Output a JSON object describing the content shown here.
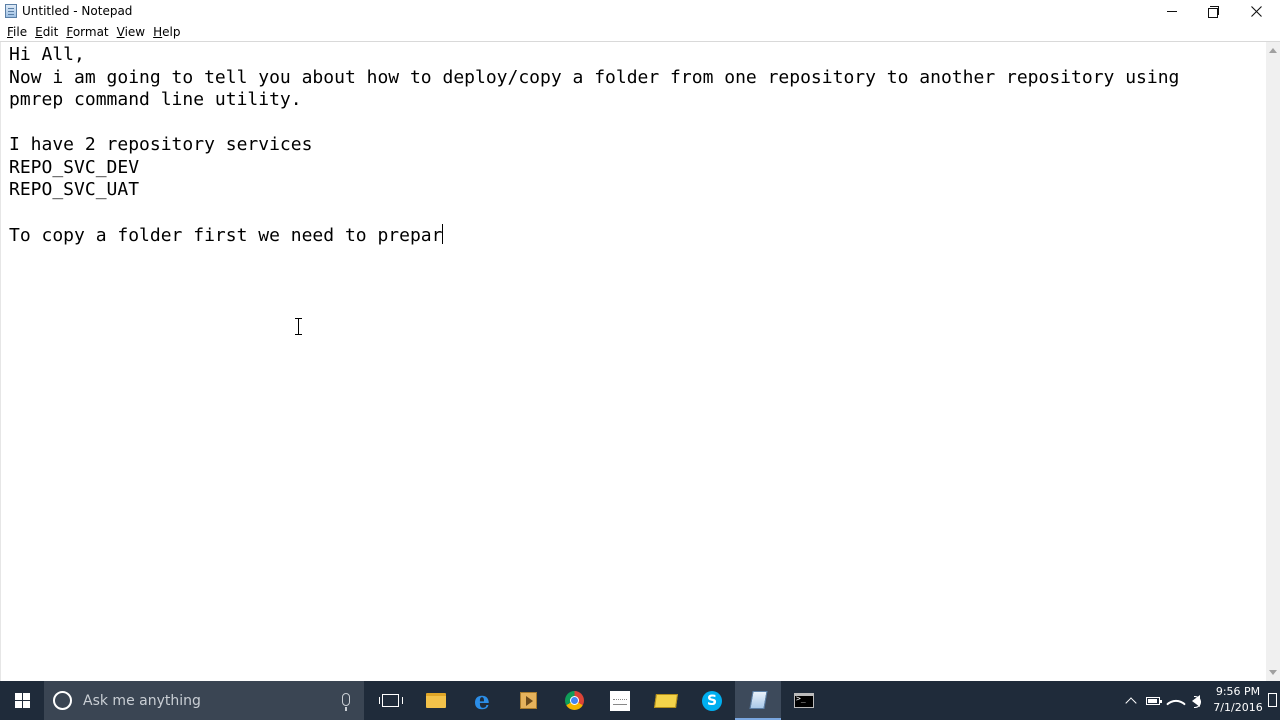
{
  "window": {
    "title": "Untitled - Notepad"
  },
  "menu": {
    "items": [
      {
        "label": "File",
        "accel": "F",
        "rest": "ile"
      },
      {
        "label": "Edit",
        "accel": "E",
        "rest": "dit"
      },
      {
        "label": "Format",
        "accel": "F",
        "rest": "ormat"
      },
      {
        "label": "View",
        "accel": "V",
        "rest": "iew"
      },
      {
        "label": "Help",
        "accel": "H",
        "rest": "elp"
      }
    ]
  },
  "editor": {
    "lines": [
      "Hi All,",
      "Now i am going to tell you about how to deploy/copy a folder from one repository to another repository using",
      "pmrep command line utility.",
      "",
      "I have 2 repository services",
      "REPO_SVC_DEV",
      "REPO_SVC_UAT",
      "",
      "To copy a folder first we need to prepar"
    ]
  },
  "taskbar": {
    "search_placeholder": "Ask me anything",
    "icons": [
      "task-view-icon",
      "file-explorer-icon",
      "edge-icon",
      "media-player-icon",
      "chrome-icon",
      "paint-icon",
      "mail-icon",
      "skype-icon",
      "notepad-icon",
      "command-prompt-icon"
    ],
    "skype_glyph": "S",
    "clock": {
      "time": "9:56 PM",
      "date": "7/1/2016"
    }
  },
  "colors": {
    "taskbar_bg": "#1f2b3a",
    "search_bg": "#3a4553",
    "active_indicator": "#7aa7e0"
  }
}
